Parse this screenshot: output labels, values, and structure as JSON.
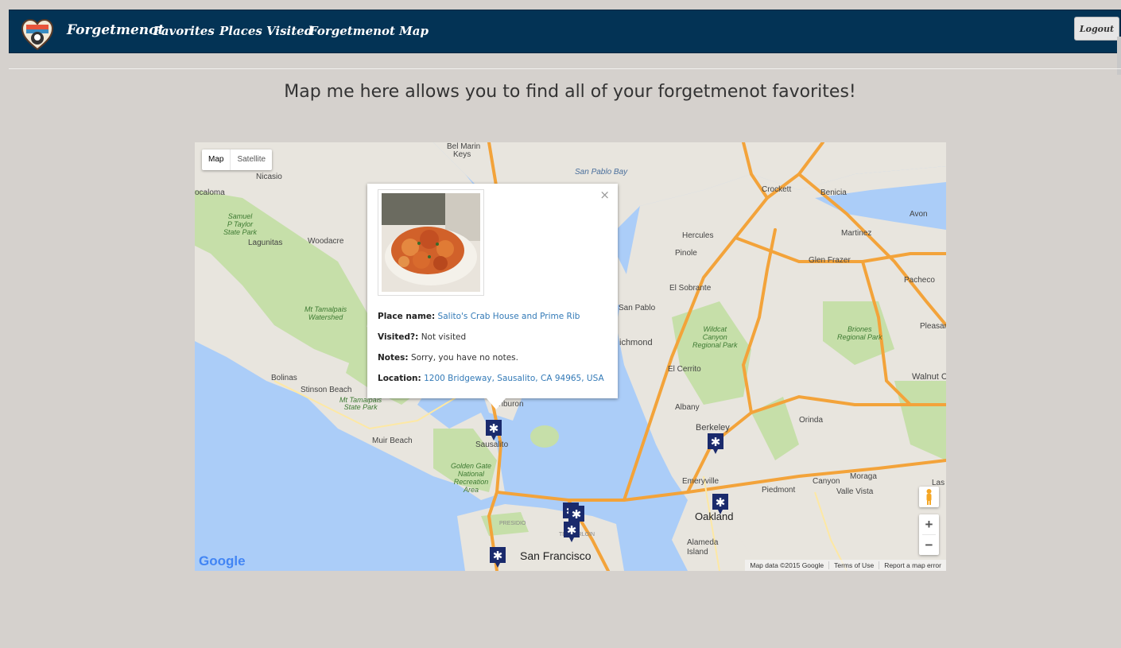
{
  "nav": {
    "brand": "Forgetmenot",
    "links": [
      "Favorites",
      "Places Visited",
      "Forgetmenot Map"
    ],
    "logout": "Logout"
  },
  "headline": "Map me here allows you to find all of your forgetmenot favorites!",
  "map": {
    "type_controls": [
      "Map",
      "Satellite"
    ],
    "labels": {
      "bel_marin": "Bel Marin",
      "keys": "Keys",
      "san_pablo_bay": "San Pablo Bay",
      "nicasio": "Nicasio",
      "olema": "ocaloma",
      "samuel_taylor": "Samuel\nP Taylor\nState Park",
      "lagunitas": "Lagunitas",
      "woodacre": "Woodacre",
      "mt_tam": "Mt Tamalpais\nWatershed",
      "bolinas": "Bolinas",
      "stinson": "Stinson Beach",
      "mt_tam_sp": "Mt Tamalpais\nState Park",
      "muir": "Muir Beach",
      "sausalito": "Sausalito",
      "belvedere": "Belvedere\nTiburon",
      "ggnra": "Golden Gate\nNational\nRecreation\nArea",
      "presidio": "PRESIDIO",
      "tenderloin": "TENDERLOIN",
      "sf": "San Francisco",
      "crockett": "Crockett",
      "benicia": "Benicia",
      "hercules": "Hercules",
      "martinez": "Martinez",
      "avon": "Avon",
      "pinole": "Pinole",
      "glen_frazer": "Glen Frazer",
      "pacheco": "Pacheco",
      "el_sobrante": "El Sobrante",
      "san_pablo": "San Pablo",
      "wildcat": "Wildcat\nCanyon\nRegional Park",
      "briones": "Briones\nRegional Park",
      "pleasant": "Pleasant",
      "richmond": "ichmond",
      "el_cerrito": "El Cerrito",
      "walnut": "Walnut Cr",
      "albany": "Albany",
      "orinda": "Orinda",
      "berkeley": "Berkeley",
      "emeryville": "Emeryville",
      "piedmont": "Piedmont",
      "canyon": "Canyon",
      "moraga": "Moraga",
      "valle": "Valle Vista",
      "oakland": "Oakland",
      "alameda": "Alameda\nIsland",
      "las": "Las"
    },
    "attribution": [
      "Map data ©2015 Google",
      "Terms of Use",
      "Report a map error"
    ],
    "google": "Google",
    "zoom_in": "+",
    "zoom_out": "−"
  },
  "popup": {
    "close": "×",
    "place_label": "Place name:",
    "place_value": "Salito's Crab House and Prime Rib",
    "visited_label": "Visited?:",
    "visited_value": "Not visited",
    "notes_label": "Notes:",
    "notes_value": "Sorry, you have no notes.",
    "location_label": "Location:",
    "location_value": "1200 Bridgeway, Sausalito, CA 94965, USA"
  },
  "colors": {
    "navbar": "#033355",
    "page_bg": "#d5d1cd",
    "water": "#abcdf8",
    "land": "#e8e5de",
    "park": "#c6dfa9",
    "highway": "#f3a33a",
    "marker": "#1a2a6c"
  }
}
